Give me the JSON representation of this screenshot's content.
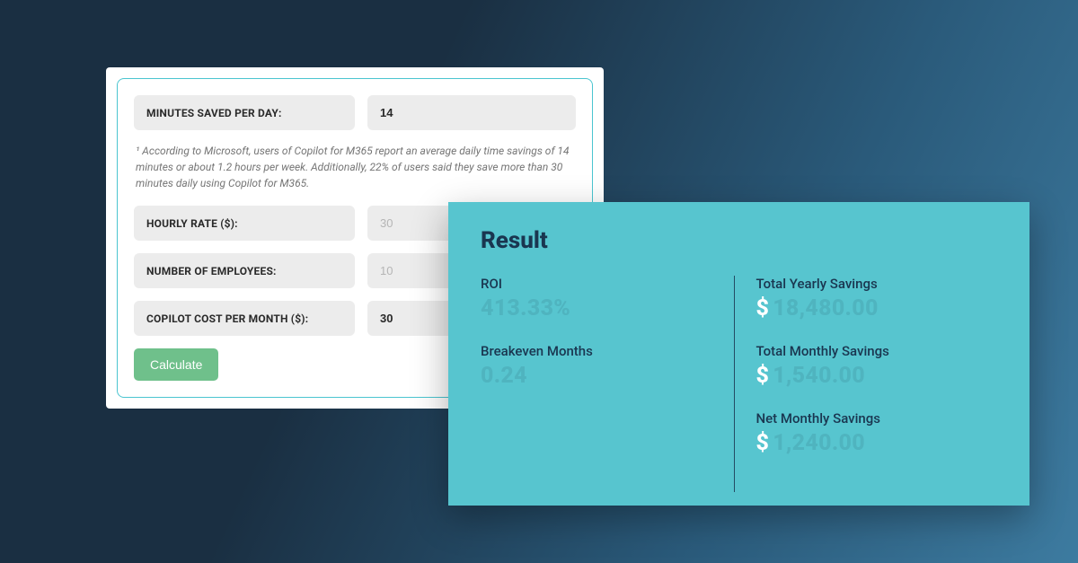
{
  "calculator": {
    "fields": {
      "minutes_saved": {
        "label": "MINUTES SAVED PER DAY:",
        "value": "14"
      },
      "hourly_rate": {
        "label": "HOURLY RATE ($):",
        "placeholder": "30"
      },
      "num_employees": {
        "label": "NUMBER OF EMPLOYEES:",
        "placeholder": "10"
      },
      "copilot_cost": {
        "label": "COPILOT COST PER MONTH ($):",
        "value": "30"
      }
    },
    "footnote": "¹ According to Microsoft, users of Copilot for M365 report an average daily time savings of 14 minutes or about 1.2 hours per week. Additionally, 22% of users said they save more than 30 minutes daily using Copilot for M365.",
    "button": "Calculate"
  },
  "result": {
    "title": "Result",
    "roi": {
      "label": "ROI",
      "value": "413.33%"
    },
    "breakeven": {
      "label": "Breakeven Months",
      "value": "0.24"
    },
    "yearly_savings": {
      "label": "Total Yearly Savings",
      "value": "18,480.00"
    },
    "monthly_savings": {
      "label": "Total Monthly Savings",
      "value": "1,540.00"
    },
    "net_monthly": {
      "label": "Net Monthly Savings",
      "value": "1,240.00"
    },
    "currency": "$"
  }
}
